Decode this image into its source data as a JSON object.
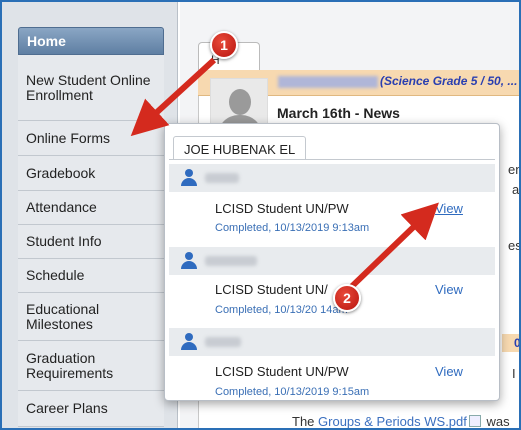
{
  "sidebar": {
    "items": [
      {
        "label": "Home"
      },
      {
        "label": "New Student Online Enrollment"
      },
      {
        "label": "Online Forms"
      },
      {
        "label": "Gradebook"
      },
      {
        "label": "Attendance"
      },
      {
        "label": "Student Info"
      },
      {
        "label": "Schedule"
      },
      {
        "label": "Educational Milestones"
      },
      {
        "label": "Graduation Requirements"
      },
      {
        "label": "Career Plans"
      }
    ]
  },
  "background": {
    "tab_fragment": "H",
    "class_label": "(Science Grade 5 / 50, ...",
    "news_date": "March 16th - News",
    "fragments": [
      "en",
      "a",
      "es",
      "0",
      "I"
    ],
    "bottom_text_prefix": "The",
    "bottom_link": "Groups & Periods WS.pdf",
    "bottom_text_suffix": "was"
  },
  "popup": {
    "school_tab": "JOE HUBENAK EL",
    "entries": [
      {
        "form_title": "LCISD Student UN/PW",
        "status": "Completed, 10/13/2019 9:13am",
        "action": "View"
      },
      {
        "form_title": "LCISD Student UN/",
        "status": "Completed, 10/13/20   14am",
        "action": "View"
      },
      {
        "form_title": "LCISD Student UN/PW",
        "status": "Completed, 10/13/2019 9:15am",
        "action": "View"
      }
    ]
  },
  "callouts": {
    "first": "1",
    "second": "2"
  },
  "colors": {
    "accent": "#2f6bbf",
    "callout": "#d42a1e",
    "home_bg": "#6f8db0"
  },
  "icons": {
    "student": "person-icon",
    "pdf": "pdf-icon"
  }
}
